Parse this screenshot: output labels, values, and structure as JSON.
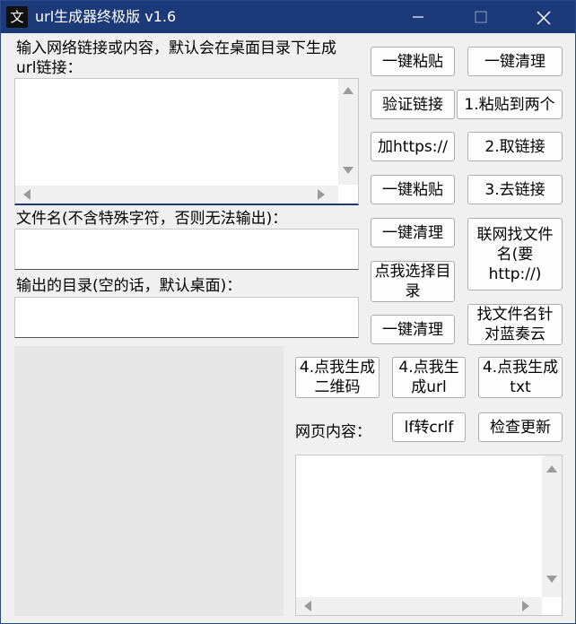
{
  "titlebar": {
    "title": "url生成器终极版 v1.6",
    "icon": "app-logo-icon"
  },
  "labels": {
    "url_input": "输入网络链接或内容，默认会在桌面目录下生成\nurl链接：",
    "filename": "文件名(不含特殊字符，否则无法输出)：",
    "output_dir": "输出的目录(空的话，默认桌面)：",
    "web_content": "网页内容："
  },
  "buttons": {
    "paste1": "一键粘贴",
    "clear1": "一键清理",
    "verify": "验证链接",
    "paste_two": "1.粘贴到两个",
    "add_https": "加https://",
    "get_link": "2.取链接",
    "paste2": "一键粘贴",
    "remove_link": "3.去链接",
    "clear2": "一键清理",
    "online_find": "联网找文件\n名(要\nhttp://)",
    "choose_dir": "点我选择目\n录",
    "clear3": "一键清理",
    "find_lanzou": "找文件名针\n对蓝奏云",
    "gen_qr": "4.点我生成\n二维码",
    "gen_url": "4.点我生\n成url",
    "gen_txt": "4.点我生成\ntxt",
    "lf_crlf": "lf转crlf",
    "check_update": "检查更新"
  }
}
